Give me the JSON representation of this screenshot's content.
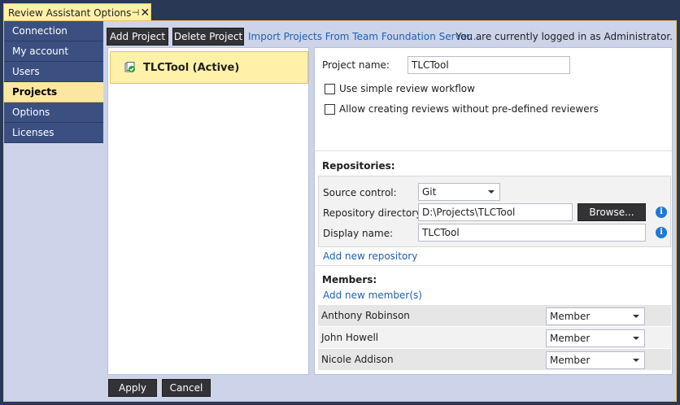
{
  "tab": {
    "title": "Review Assistant Options",
    "pin_glyph": "⊣",
    "close_glyph": "✕"
  },
  "colors": {
    "accent": "#fff1a8",
    "nav_bg": "#3b4f81",
    "link": "#1e5fb8",
    "window_bg": "#cdd4e9"
  },
  "sidebar": {
    "items": [
      {
        "label": "Connection"
      },
      {
        "label": "My account"
      },
      {
        "label": "Users"
      },
      {
        "label": "Projects",
        "active": true
      },
      {
        "label": "Options"
      },
      {
        "label": "Licenses"
      }
    ]
  },
  "toolbar": {
    "add_project": "Add Project",
    "delete_project": "Delete Project",
    "import_link": "Import Projects From Team Foundation Server...",
    "login_status": "You are currently logged in as Administrator."
  },
  "projects": [
    {
      "name": "TLCTool (Active)",
      "icon": "project-check-icon"
    }
  ],
  "details": {
    "project_name_label": "Project name:",
    "project_name_value": "TLCTool",
    "simple_workflow_label": "Use simple review workflow",
    "allow_no_reviewers_label": "Allow creating reviews without pre-defined reviewers",
    "repositories_header": "Repositories:",
    "repo": {
      "source_control_label": "Source control:",
      "source_control_value": "Git",
      "directory_label": "Repository directory:",
      "directory_value": "D:\\Projects\\TLCTool",
      "browse_label": "Browse...",
      "display_name_label": "Display name:",
      "display_name_value": "TLCTool",
      "info_glyph": "i"
    },
    "add_repository": "Add new repository",
    "members_header": "Members:",
    "add_member": "Add new member(s)",
    "members": [
      {
        "name": "Anthony Robinson",
        "role": "Member"
      },
      {
        "name": "John Howell",
        "role": "Member"
      },
      {
        "name": "Nicole Addison",
        "role": "Member"
      }
    ]
  },
  "footer": {
    "apply": "Apply",
    "cancel": "Cancel"
  }
}
